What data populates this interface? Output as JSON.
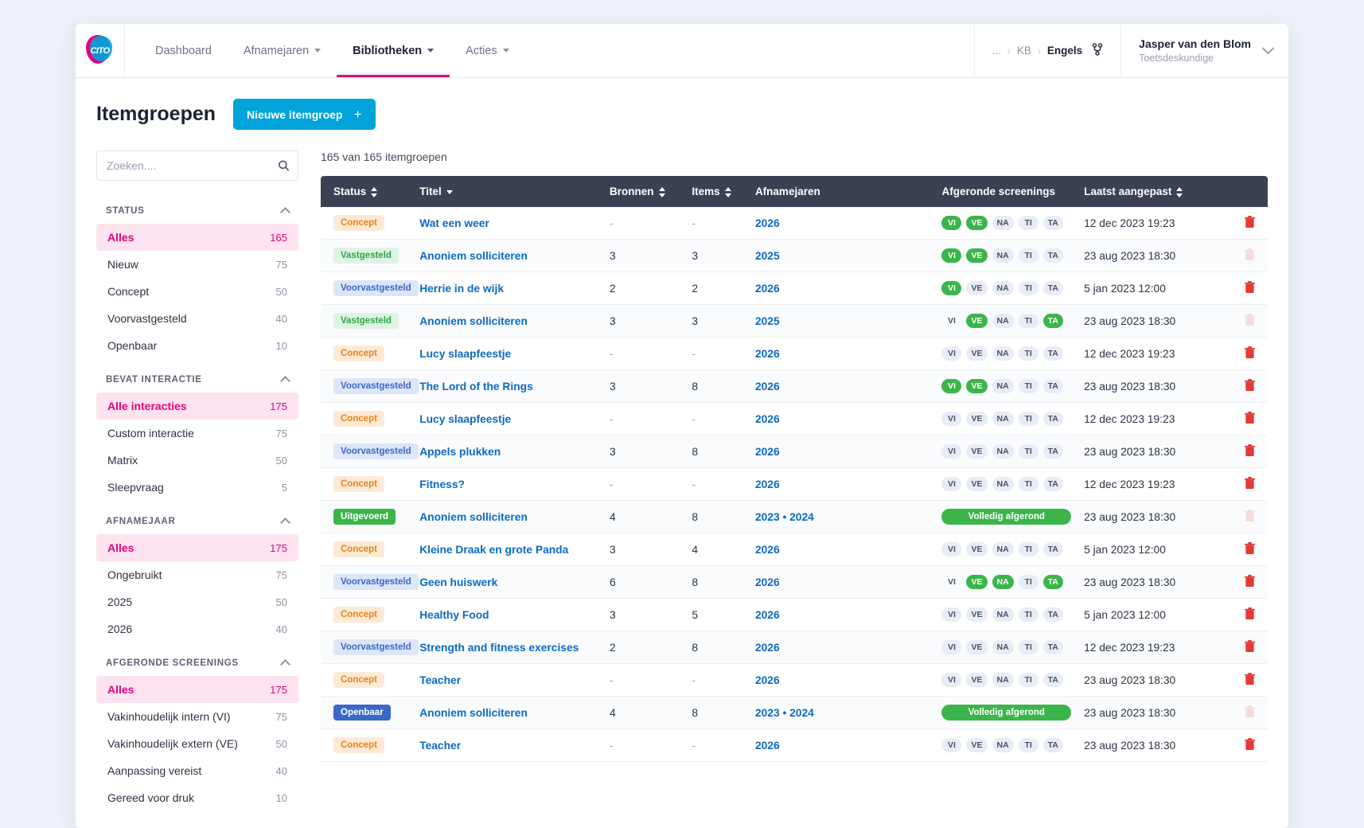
{
  "header": {
    "logo_text": "CITO",
    "nav": [
      {
        "label": "Dashboard",
        "caret": false,
        "active": false
      },
      {
        "label": "Afnamejaren",
        "caret": true,
        "active": false
      },
      {
        "label": "Bibliotheken",
        "caret": true,
        "active": true
      },
      {
        "label": "Acties",
        "caret": true,
        "active": false
      }
    ],
    "breadcrumb": {
      "ellipsis": "...",
      "items": [
        "KB",
        "Engels"
      ],
      "separator": "›"
    },
    "user": {
      "name": "Jasper van den Blom",
      "role": "Toetsdeskundige"
    }
  },
  "page": {
    "title": "Itemgroepen",
    "new_button": "Nieuwe itemgroep",
    "count_line": "165 van 165 itemgroepen"
  },
  "search": {
    "placeholder": "Zoeken....",
    "value": ""
  },
  "sidebar": {
    "groups": [
      {
        "label": "STATUS",
        "items": [
          {
            "name": "Alles",
            "count": "165",
            "selected": true
          },
          {
            "name": "Nieuw",
            "count": "75",
            "selected": false
          },
          {
            "name": "Concept",
            "count": "50",
            "selected": false
          },
          {
            "name": "Voorvastgesteld",
            "count": "40",
            "selected": false
          },
          {
            "name": "Openbaar",
            "count": "10",
            "selected": false
          }
        ]
      },
      {
        "label": "BEVAT INTERACTIE",
        "items": [
          {
            "name": "Alle interacties",
            "count": "175",
            "selected": true
          },
          {
            "name": "Custom interactie",
            "count": "75",
            "selected": false
          },
          {
            "name": "Matrix",
            "count": "50",
            "selected": false
          },
          {
            "name": "Sleepvraag",
            "count": "5",
            "selected": false
          }
        ]
      },
      {
        "label": "AFNAMEJAAR",
        "items": [
          {
            "name": "Alles",
            "count": "175",
            "selected": true
          },
          {
            "name": "Ongebruikt",
            "count": "75",
            "selected": false
          },
          {
            "name": "2025",
            "count": "50",
            "selected": false
          },
          {
            "name": "2026",
            "count": "40",
            "selected": false
          }
        ]
      },
      {
        "label": "AFGERONDE SCREENINGS",
        "items": [
          {
            "name": "Alles",
            "count": "175",
            "selected": true
          },
          {
            "name": "Vakinhoudelijk intern (VI)",
            "count": "75",
            "selected": false
          },
          {
            "name": "Vakinhoudelijk extern (VE)",
            "count": "50",
            "selected": false
          },
          {
            "name": "Aanpassing vereist",
            "count": "40",
            "selected": false
          },
          {
            "name": "Gereed voor druk",
            "count": "10",
            "selected": false
          }
        ]
      }
    ]
  },
  "table": {
    "columns": [
      {
        "label": "Status",
        "sort": "both"
      },
      {
        "label": "Titel",
        "sort": "down"
      },
      {
        "label": "Bronnen",
        "sort": "both"
      },
      {
        "label": "Items",
        "sort": "both"
      },
      {
        "label": "Afnamejaren",
        "sort": "none"
      },
      {
        "label": "Afgeronde screenings",
        "sort": "none"
      },
      {
        "label": "Laatst aangepast",
        "sort": "both"
      },
      {
        "label": "",
        "sort": "none"
      }
    ],
    "screening_keys": [
      "VI",
      "VE",
      "NA",
      "TI",
      "TA"
    ],
    "full_label": "Volledig afgerond",
    "rows": [
      {
        "status": "Concept",
        "status_type": "concept",
        "title": "Wat een weer",
        "bronnen": "-",
        "items": "-",
        "jaren": "2026",
        "screenings": [
          "on",
          "on",
          "off",
          "off",
          "off"
        ],
        "full": false,
        "modified": "12 dec 2023 19:23",
        "delete": true
      },
      {
        "status": "Vastgesteld",
        "status_type": "vastgesteld",
        "title": "Anoniem solliciteren",
        "bronnen": "3",
        "items": "3",
        "jaren": "2025",
        "screenings": [
          "on",
          "on",
          "off",
          "off",
          "off"
        ],
        "full": false,
        "modified": "23 aug 2023 18:30",
        "delete": false
      },
      {
        "status": "Voorvastgesteld",
        "status_type": "voorvastgesteld",
        "title": "Herrie in de wijk",
        "bronnen": "2",
        "items": "2",
        "jaren": "2026",
        "screenings": [
          "on",
          "off",
          "off",
          "off",
          "off"
        ],
        "full": false,
        "modified": "5 jan 2023 12:00",
        "delete": true
      },
      {
        "status": "Vastgesteld",
        "status_type": "vastgesteld",
        "title": "Anoniem solliciteren",
        "bronnen": "3",
        "items": "3",
        "jaren": "2025",
        "screenings": [
          "none",
          "on",
          "off",
          "off",
          "on"
        ],
        "full": false,
        "modified": "23 aug 2023 18:30",
        "delete": false
      },
      {
        "status": "Concept",
        "status_type": "concept",
        "title": "Lucy slaapfeestje",
        "bronnen": "-",
        "items": "-",
        "jaren": "2026",
        "screenings": [
          "off",
          "off",
          "off",
          "off",
          "off"
        ],
        "full": false,
        "modified": "12 dec 2023 19:23",
        "delete": true
      },
      {
        "status": "Voorvastgesteld",
        "status_type": "voorvastgesteld",
        "title": "The Lord of the Rings",
        "bronnen": "3",
        "items": "8",
        "jaren": "2026",
        "screenings": [
          "on",
          "on",
          "off",
          "off",
          "off"
        ],
        "full": false,
        "modified": "23 aug 2023 18:30",
        "delete": true
      },
      {
        "status": "Concept",
        "status_type": "concept",
        "title": "Lucy slaapfeestje",
        "bronnen": "-",
        "items": "-",
        "jaren": "2026",
        "screenings": [
          "off",
          "off",
          "off",
          "off",
          "off"
        ],
        "full": false,
        "modified": "12 dec 2023 19:23",
        "delete": true
      },
      {
        "status": "Voorvastgesteld",
        "status_type": "voorvastgesteld",
        "title": "Appels plukken",
        "bronnen": "3",
        "items": "8",
        "jaren": "2026",
        "screenings": [
          "off",
          "off",
          "off",
          "off",
          "off"
        ],
        "full": false,
        "modified": "23 aug 2023 18:30",
        "delete": true
      },
      {
        "status": "Concept",
        "status_type": "concept",
        "title": "Fitness?",
        "bronnen": "-",
        "items": "-",
        "jaren": "2026",
        "screenings": [
          "off",
          "off",
          "off",
          "off",
          "off"
        ],
        "full": false,
        "modified": "12 dec 2023 19:23",
        "delete": true
      },
      {
        "status": "Uitgevoerd",
        "status_type": "uitgevoerd",
        "title": "Anoniem solliciteren",
        "bronnen": "4",
        "items": "8",
        "jaren": "2023 • 2024",
        "screenings": [],
        "full": true,
        "modified": "23 aug 2023 18:30",
        "delete": false
      },
      {
        "status": "Concept",
        "status_type": "concept",
        "title": "Kleine Draak en grote Panda",
        "bronnen": "3",
        "items": "4",
        "jaren": "2026",
        "screenings": [
          "off",
          "off",
          "off",
          "off",
          "off"
        ],
        "full": false,
        "modified": "5 jan 2023 12:00",
        "delete": true
      },
      {
        "status": "Voorvastgesteld",
        "status_type": "voorvastgesteld",
        "title": "Geen huiswerk",
        "bronnen": "6",
        "items": "8",
        "jaren": "2026",
        "screenings": [
          "none",
          "on",
          "on",
          "off",
          "on"
        ],
        "full": false,
        "modified": "23 aug 2023 18:30",
        "delete": true
      },
      {
        "status": "Concept",
        "status_type": "concept",
        "title": "Healthy Food",
        "bronnen": "3",
        "items": "5",
        "jaren": "2026",
        "screenings": [
          "off",
          "off",
          "off",
          "off",
          "off"
        ],
        "full": false,
        "modified": "5 jan 2023 12:00",
        "delete": true
      },
      {
        "status": "Voorvastgesteld",
        "status_type": "voorvastgesteld",
        "title": "Strength and fitness exercises",
        "bronnen": "2",
        "items": "8",
        "jaren": "2026",
        "screenings": [
          "off",
          "off",
          "off",
          "off",
          "off"
        ],
        "full": false,
        "modified": "12 dec 2023 19:23",
        "delete": true
      },
      {
        "status": "Concept",
        "status_type": "concept",
        "title": "Teacher",
        "bronnen": "-",
        "items": "-",
        "jaren": "2026",
        "screenings": [
          "off",
          "off",
          "off",
          "off",
          "off"
        ],
        "full": false,
        "modified": "23 aug 2023 18:30",
        "delete": true
      },
      {
        "status": "Openbaar",
        "status_type": "openbaar",
        "title": "Anoniem solliciteren",
        "bronnen": "4",
        "items": "8",
        "jaren": "2023 • 2024",
        "screenings": [],
        "full": true,
        "modified": "23 aug 2023 18:30",
        "delete": false
      },
      {
        "status": "Concept",
        "status_type": "concept",
        "title": "Teacher",
        "bronnen": "-",
        "items": "-",
        "jaren": "2026",
        "screenings": [
          "off",
          "off",
          "off",
          "off",
          "off"
        ],
        "full": false,
        "modified": "23 aug 2023 18:30",
        "delete": true
      }
    ]
  },
  "colors": {
    "accent_pink": "#e6007e",
    "accent_blue": "#00a3da",
    "link_blue": "#0b6ac1",
    "green": "#3bb54a",
    "header_dark": "#3b4152"
  }
}
